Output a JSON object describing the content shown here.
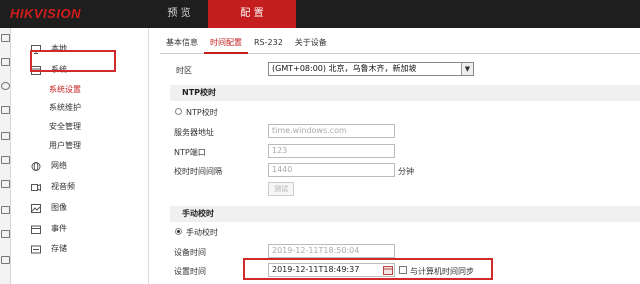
{
  "header": {
    "logo": "HIKVISION",
    "nav": {
      "preview": "预 览",
      "config": "配 置"
    }
  },
  "sidebar": {
    "items": {
      "local": "本地",
      "system": "系统",
      "network": "网络",
      "video": "视音频",
      "image": "图像",
      "event": "事件",
      "storage": "存储"
    },
    "sub": {
      "system_settings": "系统设置",
      "system_maintenance": "系统维护",
      "security": "安全管理",
      "user_management": "用户管理"
    }
  },
  "tabs": [
    "基本信息",
    "时间配置",
    "RS-232",
    "关于设备"
  ],
  "form": {
    "timezone_label": "时区",
    "timezone_value": "(GMT+08:00) 北京，乌鲁木齐，新加坡",
    "ntp_section": "NTP校时",
    "ntp_radio": "NTP校时",
    "server_label": "服务器地址",
    "server_value": "time.windows.com",
    "ntp_port_label": "NTP端口",
    "ntp_port_value": "123",
    "interval_label": "校时时间间隔",
    "interval_value": "1440",
    "interval_unit": "分钟",
    "test_button": "测试",
    "manual_section": "手动校时",
    "manual_radio": "手动校时",
    "device_time_label": "设备时间",
    "device_time_value": "2019-12-11T18:50:04",
    "set_time_label": "设置时间",
    "set_time_value": "2019-12-11T18:49:37",
    "sync_pc_label": "与计算机时间同步"
  }
}
